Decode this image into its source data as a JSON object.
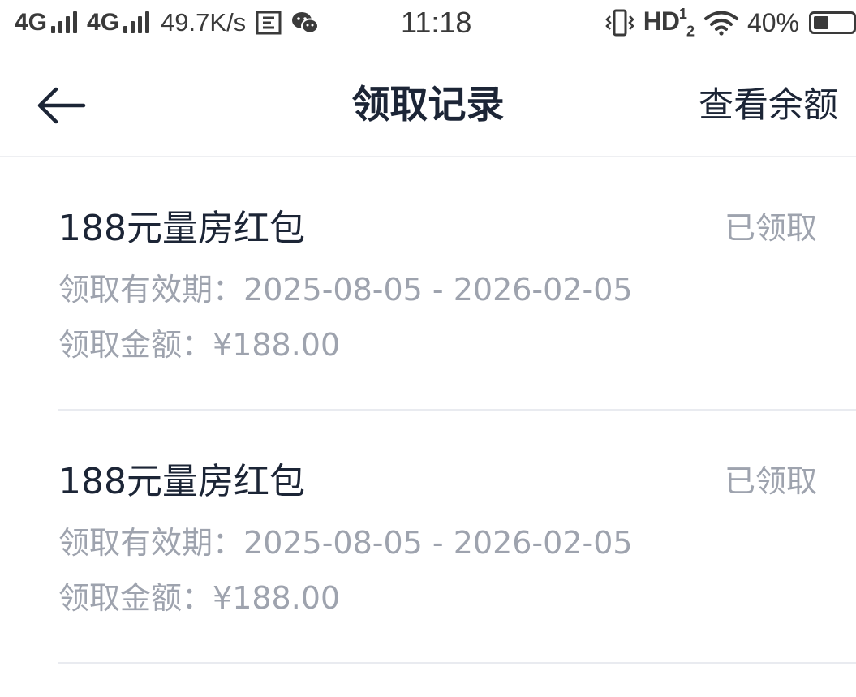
{
  "status_bar": {
    "network1": "4G",
    "network2": "4G",
    "speed": "49.7K/s",
    "time": "11:18",
    "hd": "HD",
    "hd_sup": "1",
    "hd_sub": "2",
    "battery_percent": "40%",
    "battery_level": 0.4,
    "icons": [
      "signal-icon",
      "sim-icon",
      "wechat-icon",
      "vibrate-icon",
      "wifi-icon",
      "battery-icon"
    ]
  },
  "nav": {
    "title": "领取记录",
    "action": "查看余额",
    "back_icon": "arrow-left-icon"
  },
  "records": [
    {
      "title": "188元量房红包",
      "status": "已领取",
      "validity_label": "领取有效期：",
      "validity_value": "2025-08-05 - 2026-02-05",
      "amount_label": "领取金额：",
      "amount_value": "¥188.00"
    },
    {
      "title": "188元量房红包",
      "status": "已领取",
      "validity_label": "领取有效期：",
      "validity_value": "2025-08-05 - 2026-02-05",
      "amount_label": "领取金额：",
      "amount_value": "¥188.00"
    }
  ],
  "colors": {
    "text_primary": "#1c2536",
    "text_secondary": "#9ea3ae",
    "divider": "#e9ebf0"
  }
}
